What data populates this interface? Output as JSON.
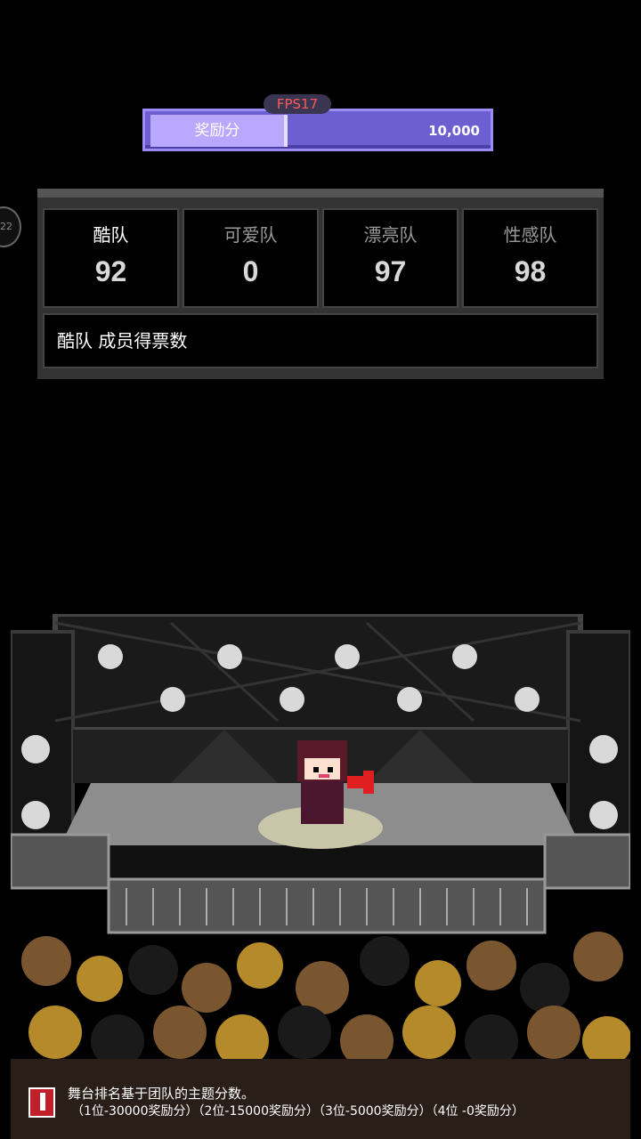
{
  "hud": {
    "fps": "FPS17",
    "bonus_label": "奖励分",
    "bonus_value": "10,000",
    "side_badge": "22"
  },
  "teams": [
    {
      "name": "酷队",
      "score": "92"
    },
    {
      "name": "可爱队",
      "score": "0"
    },
    {
      "name": "漂亮队",
      "score": "97"
    },
    {
      "name": "性感队",
      "score": "98"
    }
  ],
  "caption": "酷队 成员得票数",
  "footer": {
    "line1": "舞台排名基于团队的主题分数。",
    "line2": "（1位-30000奖励分）（2位-15000奖励分）（3位-5000奖励分）（4位 -0奖励分）"
  },
  "colors": {
    "bonus_bar": "#6e5fd0",
    "bonus_label_bg": "#b8a9ff",
    "fps_text": "#ff5a5a",
    "notice_icon": "#c0202a"
  }
}
